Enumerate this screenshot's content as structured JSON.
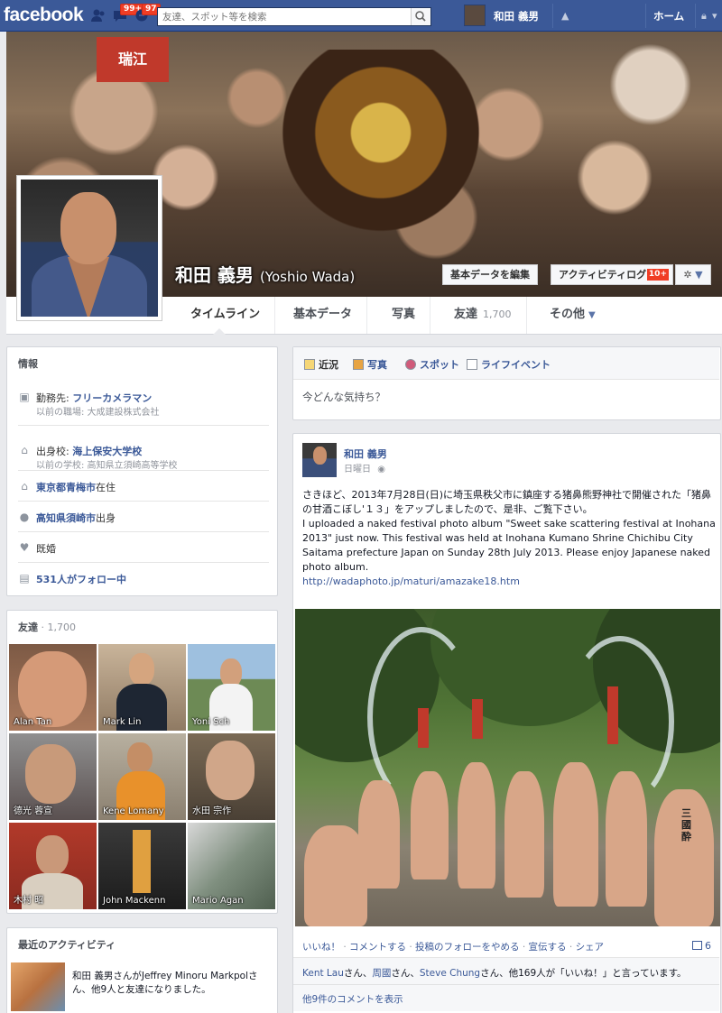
{
  "topbar": {
    "logo": "facebook",
    "friend_requests_badge": "",
    "messages_badge": "99+",
    "notifications_badge": "97",
    "search_placeholder": "友達、スポット等を検索",
    "user_name": "和田 義男",
    "home_label": "ホーム"
  },
  "cover": {
    "sign_text": "瑞江",
    "name": "和田 義男",
    "name_latin": "(Yoshio Wada)",
    "edit_button": "基本データを編集",
    "activity_button": "アクティビティログ",
    "activity_count": "10+"
  },
  "tabs": {
    "timeline": "タイムライン",
    "about": "基本データ",
    "photos": "写真",
    "friends": "友達",
    "friends_count": "1,700",
    "more": "その他"
  },
  "info": {
    "heading": "情報",
    "work": {
      "prefix": "勤務先: ",
      "value": "フリーカメラマン",
      "sub": "以前の職場: 大成建設株式会社"
    },
    "school": {
      "prefix": "出身校: ",
      "value": "海上保安大学校",
      "sub": "以前の学校: 高知県立須崎高等学校"
    },
    "lives": {
      "value": "東京都青梅市",
      "suffix": "在住"
    },
    "from": {
      "value": "高知県須崎市",
      "suffix": "出身"
    },
    "relationship": "既婚",
    "followers": "531人がフォロー中"
  },
  "friends": {
    "heading": "友達",
    "count": "1,700",
    "items": [
      {
        "name": "Alan Tan"
      },
      {
        "name": "Mark Lin"
      },
      {
        "name": "Yoni Sch"
      },
      {
        "name": "德光 蓉宣"
      },
      {
        "name": "Kene Lomany"
      },
      {
        "name": "水田 宗作"
      },
      {
        "name": "木村 昭"
      },
      {
        "name": "John Mackenn"
      },
      {
        "name": "Mario Agan"
      }
    ]
  },
  "recent_activity": {
    "heading": "最近のアクティビティ",
    "text_name": "和田 義男",
    "text_mid": "さんが",
    "text_friend": "Jeffrey Minoru Markpol",
    "text_end": "さん、他9人と友達になりました。"
  },
  "composer": {
    "tab_status": "近況",
    "tab_photo": "写真",
    "tab_place": "スポット",
    "tab_life": "ライフイベント",
    "placeholder": "今どんな気持ち？"
  },
  "post": {
    "author": "和田 義男",
    "date": "日曜日",
    "text_ja": "さきほど、2013年7月28日(日)に埼玉県秩父市に鎮座する猪鼻熊野神社で開催された「猪鼻の甘酒こぼし'１３」をアップしましたので、是非、ご覧下さい。",
    "text_en": "I uploaded a naked festival photo album \"Sweet sake scattering festival at Inohana 2013\" just now. This festival was held at Inohana Kumano Shrine Chichibu City Saitama prefecture Japan on Sunday 28th July 2013. Please enjoy Japanese naked photo album.",
    "url": "http://wadaphoto.jp/maturi/amazake18.htm",
    "photo_tattoo_text": "三國酔",
    "actions": [
      "いいね！",
      "コメントする",
      "投稿のフォローをやめる",
      "宣伝する",
      "シェア"
    ],
    "comment_count": "6",
    "likes": {
      "name1": "Kent Lau",
      "sep1": "さん、",
      "name2": "周國",
      "sep2": "さん、",
      "name3": "Steve Chung",
      "tail": "さん、他169人が「いいね！」と言っています。"
    },
    "more_comments": "他9件のコメントを表示"
  }
}
